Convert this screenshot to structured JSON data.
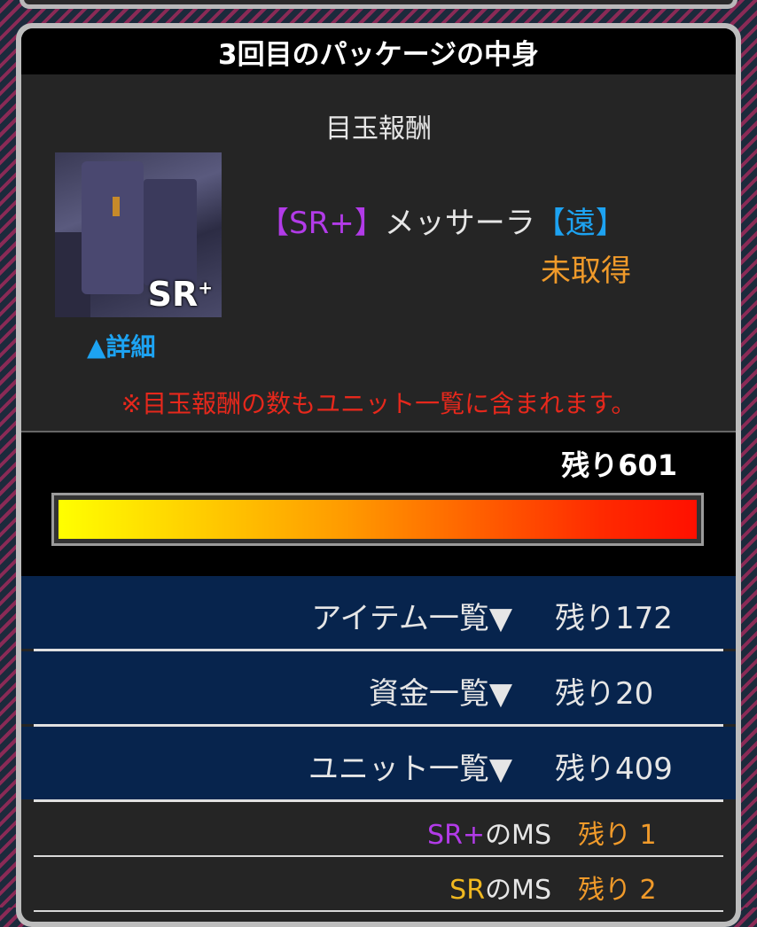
{
  "panel": {
    "title": "3回目のパッケージの中身",
    "featured_heading": "目玉報酬"
  },
  "featured_unit": {
    "rarity": "【SR+】",
    "name": "メッサーラ",
    "range": "【遠】",
    "status": "未取得",
    "thumb_badge": "SR",
    "thumb_badge_sup": "+",
    "detail_link": "▲詳細",
    "note": "※目玉報酬の数もユニット一覧に含まれます。"
  },
  "remaining": {
    "total_label": "残り601",
    "progress_fraction": 1.0
  },
  "lists": [
    {
      "label": "アイテム一覧▼",
      "count": "残り172"
    },
    {
      "label": "資金一覧▼",
      "count": "残り20"
    },
    {
      "label": "ユニット一覧▼",
      "count": "残り409"
    }
  ],
  "unit_breakdown": [
    {
      "rarity": "SR+",
      "suffix": "のMS",
      "count": "残り 1",
      "rarity_color": "#b23be8"
    },
    {
      "rarity": "SR",
      "suffix": "のMS",
      "count": "残り 2",
      "rarity_color": "#f0b820"
    }
  ],
  "colors": {
    "accent_purple": "#b23be8",
    "accent_blue": "#1da3f2",
    "accent_orange": "#f09a2a",
    "note_red": "#e6281c",
    "list_navy": "#07244d"
  }
}
